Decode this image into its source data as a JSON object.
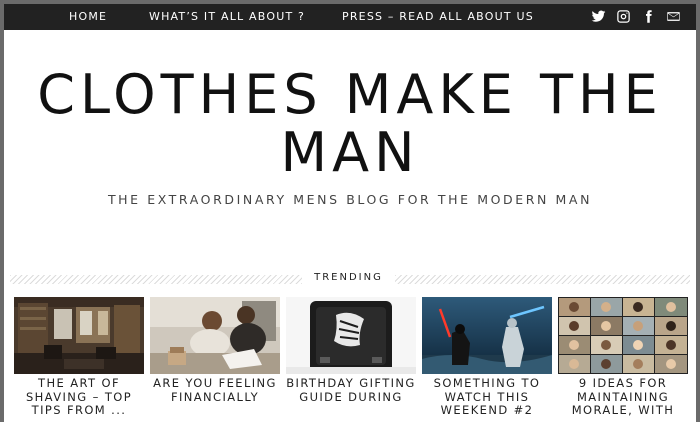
{
  "nav": {
    "items": [
      {
        "label": "HOME"
      },
      {
        "label": "WHAT’S IT ALL ABOUT ?"
      },
      {
        "label": "PRESS – READ ALL ABOUT US"
      }
    ],
    "social_icons": [
      "twitter-icon",
      "instagram-icon",
      "facebook-icon",
      "email-icon"
    ]
  },
  "header": {
    "title": "CLOTHES MAKE THE MAN",
    "tagline": "THE EXTRAORDINARY MENS BLOG FOR THE MODERN MAN"
  },
  "trending": {
    "label": "TRENDING",
    "posts": [
      {
        "title": "THE ART OF SHAVING – TOP TIPS FROM ..."
      },
      {
        "title": "ARE YOU FEELING FINANCIALLY"
      },
      {
        "title": "BIRTHDAY GIFTING GUIDE DURING"
      },
      {
        "title": "SOMETHING TO WATCH THIS WEEKEND #2"
      },
      {
        "title": "9 IDEAS FOR MAINTAINING MORALE, WITH"
      }
    ]
  },
  "colors": {
    "nav_bg": "#222222",
    "outer_frame": "#6b6b6b",
    "text_dark": "#111111"
  }
}
